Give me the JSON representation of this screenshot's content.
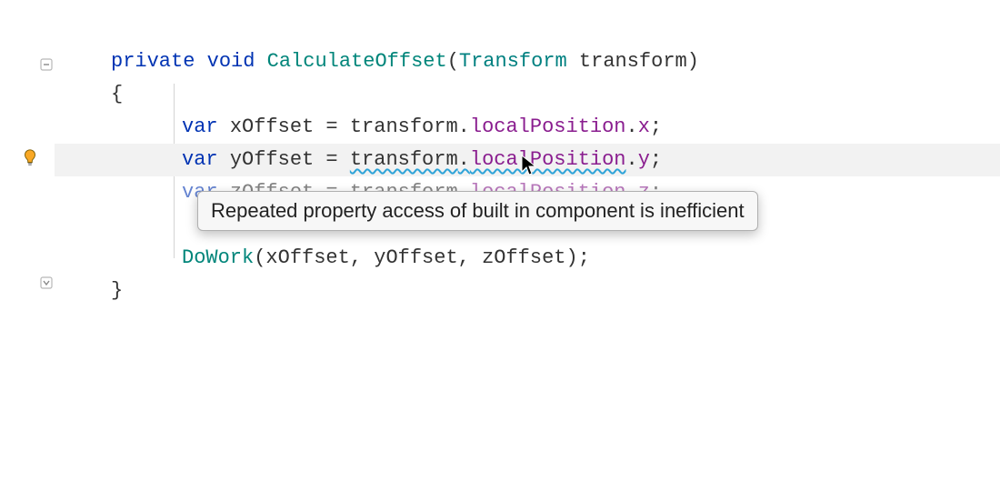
{
  "code": {
    "line1": {
      "kw_private": "private",
      "kw_void": "void",
      "method": "CalculateOffset",
      "lparen": "(",
      "param_type": "Transform",
      "param_name": "transform",
      "rparen": ")"
    },
    "line2": {
      "brace": "{"
    },
    "line3": {
      "kw_var": "var",
      "name": "xOffset",
      "eq": " = ",
      "obj": "transform",
      "dot1": ".",
      "prop": "localPosition",
      "dot2": ".",
      "member": "x",
      "semi": ";"
    },
    "line4": {
      "kw_var": "var",
      "name": "yOffset",
      "eq": " = ",
      "obj": "transform",
      "dot1": ".",
      "prop": "localPosition",
      "dot2": ".",
      "member": "y",
      "semi": ";"
    },
    "line5": {
      "kw_var": "var",
      "name": "zOffset",
      "eq": " = ",
      "obj": "transform",
      "dot1": ".",
      "prop": "localPosition",
      "dot2": ".",
      "member": "z",
      "semi": ";"
    },
    "line6": {
      "method": "DoWork",
      "lparen": "(",
      "arg1": "xOffset",
      "c1": ", ",
      "arg2": "yOffset",
      "c2": ", ",
      "arg3": "zOffset",
      "rparen": ")",
      "semi": ";"
    },
    "line7": {
      "brace": "}"
    }
  },
  "tooltip": {
    "text": "Repeated property access of built in component is inefficient"
  },
  "icons": {
    "bulb": "lightbulb-icon",
    "fold_open": "fold-open-icon",
    "fold_close": "fold-close-icon"
  }
}
